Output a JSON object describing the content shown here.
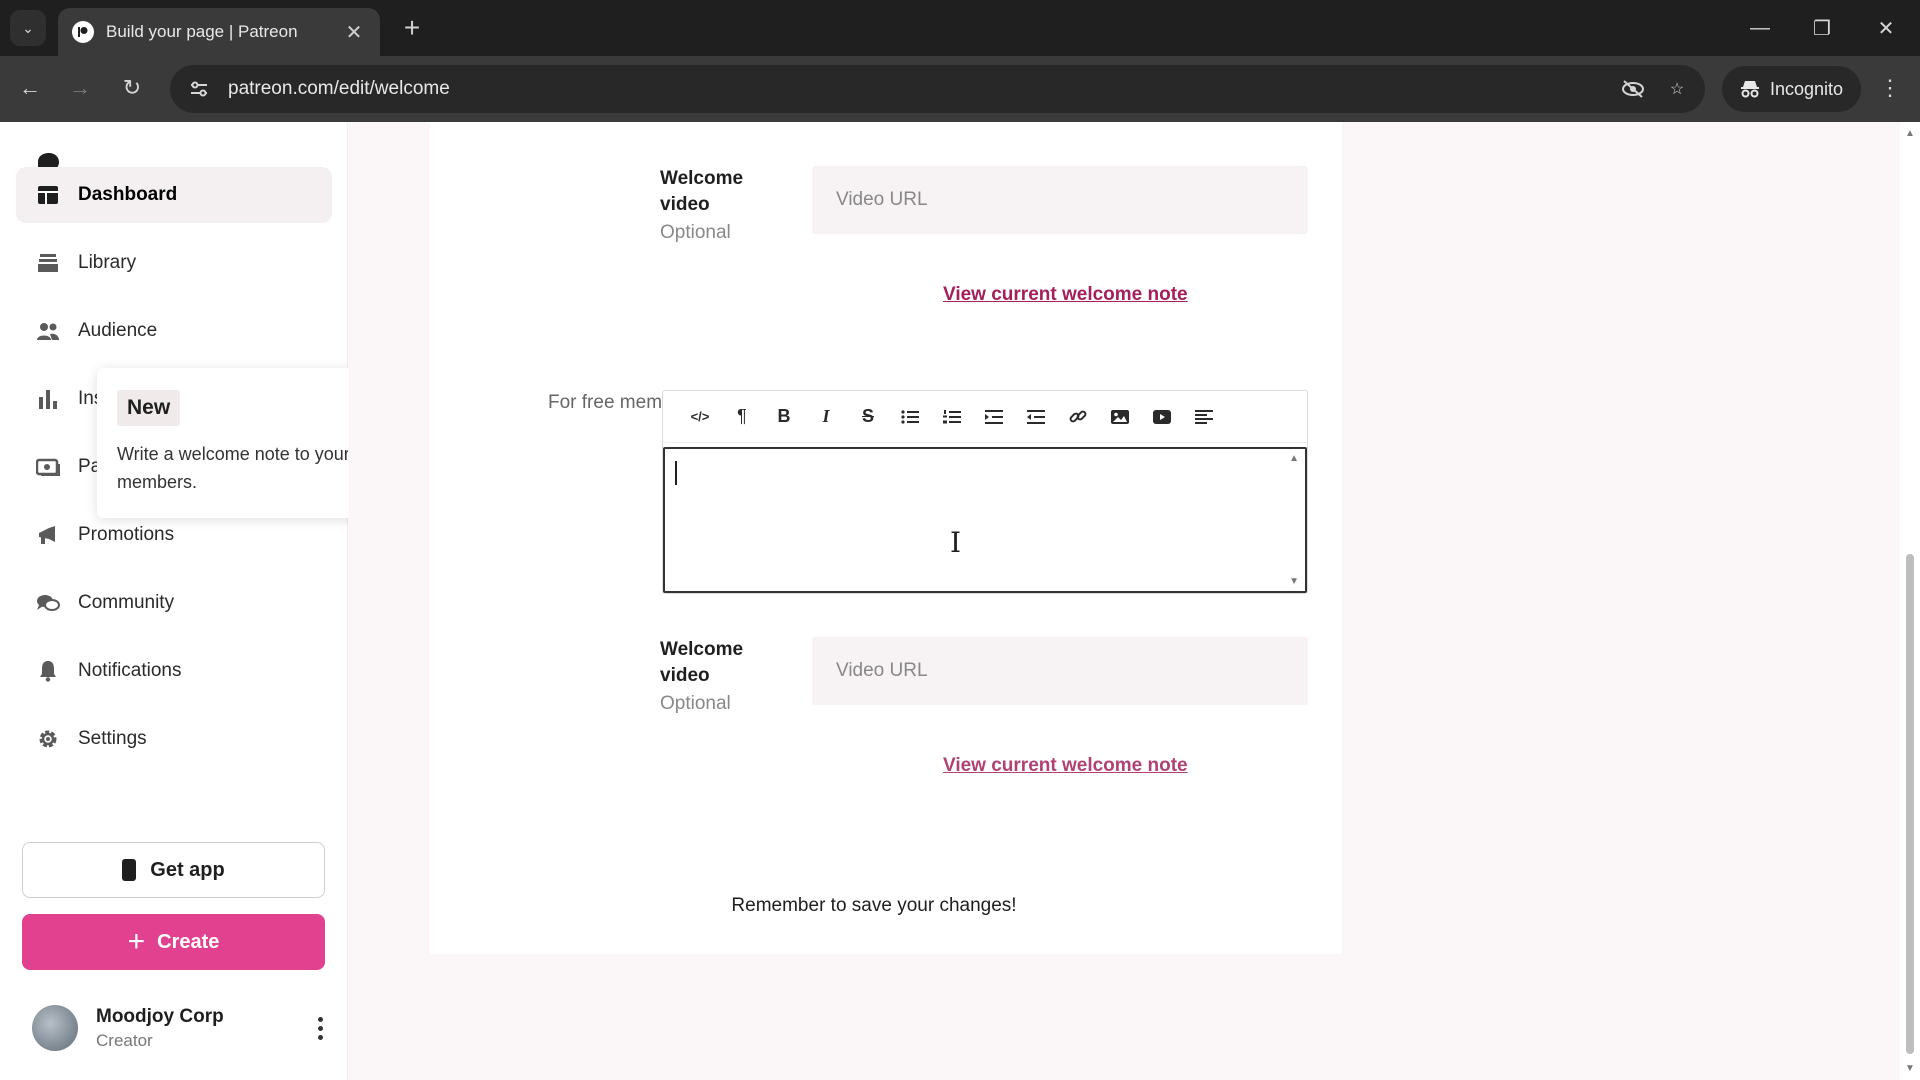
{
  "browser": {
    "tab_title": "Build your page | Patreon",
    "url": "patreon.com/edit/welcome",
    "incognito_label": "Incognito"
  },
  "sidebar": {
    "items": [
      {
        "label": "Dashboard",
        "icon": "dashboard-icon"
      },
      {
        "label": "Library",
        "icon": "library-icon"
      },
      {
        "label": "Audience",
        "icon": "audience-icon"
      },
      {
        "label": "Insights",
        "icon": "insights-icon"
      },
      {
        "label": "Payouts",
        "icon": "payouts-icon"
      },
      {
        "label": "Promotions",
        "icon": "megaphone-icon"
      },
      {
        "label": "Community",
        "icon": "chat-icon"
      },
      {
        "label": "Notifications",
        "icon": "bell-icon"
      },
      {
        "label": "Settings",
        "icon": "gear-icon"
      }
    ],
    "get_app_label": "Get app",
    "create_label": "Create",
    "user": {
      "name": "Moodjoy Corp",
      "role": "Creator"
    }
  },
  "tooltip": {
    "badge": "New",
    "text": "Write a welcome note to your free members."
  },
  "main": {
    "welcome_video_label_line1": "Welcome",
    "welcome_video_label_line2": "video",
    "optional_label": "Optional",
    "video_placeholder": "Video URL",
    "view_note_link": "View current welcome note",
    "free_members_label": "For free members",
    "save_reminder": "Remember to save your changes!"
  },
  "colors": {
    "accent": "#e2418f",
    "link": "#a3205c"
  }
}
